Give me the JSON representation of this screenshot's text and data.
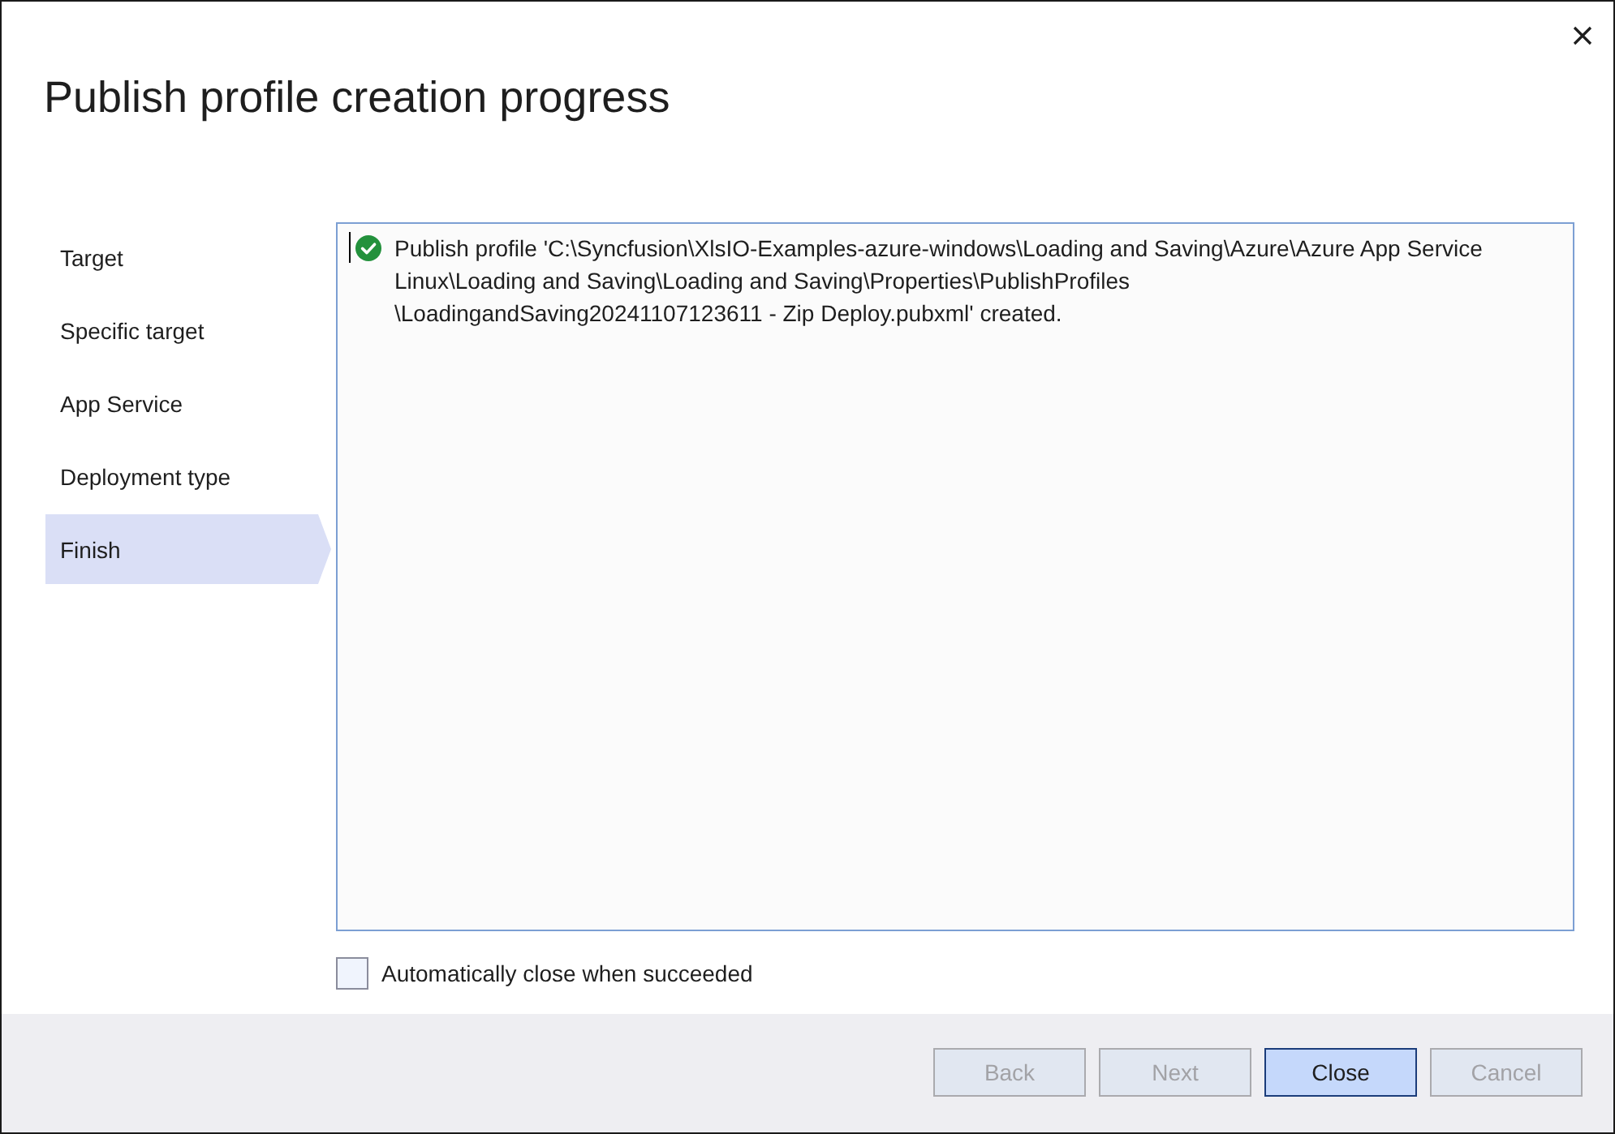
{
  "window": {
    "title": "Publish profile creation progress"
  },
  "steps": [
    {
      "label": "Target",
      "selected": false
    },
    {
      "label": "Specific target",
      "selected": false
    },
    {
      "label": "App Service",
      "selected": false
    },
    {
      "label": "Deployment type",
      "selected": false
    },
    {
      "label": "Finish",
      "selected": true
    }
  ],
  "log": {
    "entries": [
      {
        "kind": "success",
        "text": "Publish profile 'C:\\Syncfusion\\XlsIO-Examples-azure-windows\\Loading and Saving\\Azure\\Azure App Service Linux\\Loading and Saving\\Loading and Saving\\Properties\\PublishProfiles\\LoadingandSaving20241107123611 - Zip Deploy.pubxml' created."
      }
    ]
  },
  "auto_close": {
    "label": "Automatically close when succeeded",
    "checked": false
  },
  "buttons": [
    {
      "label": "Back",
      "disabled": true,
      "focused": false
    },
    {
      "label": "Next",
      "disabled": true,
      "focused": false
    },
    {
      "label": "Close",
      "disabled": false,
      "focused": true
    },
    {
      "label": "Cancel",
      "disabled": true,
      "focused": false
    }
  ]
}
